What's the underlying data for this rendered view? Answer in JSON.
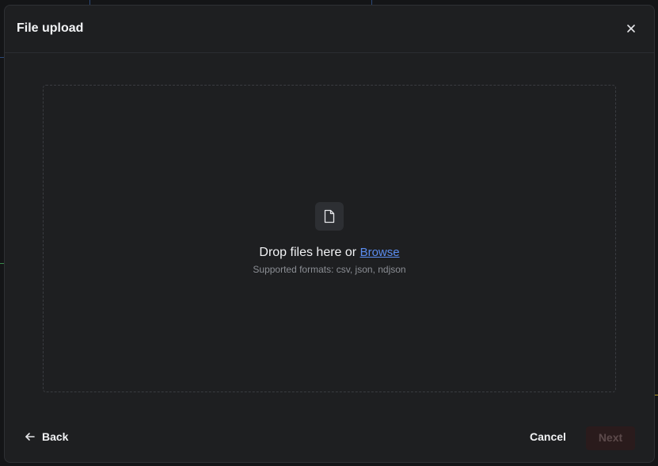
{
  "modal": {
    "title": "File upload",
    "close_icon": "close-icon"
  },
  "dropzone": {
    "icon": "file-icon",
    "prompt": "Drop files here or",
    "browse_label": "Browse",
    "formats_text": "Supported formats: csv, json, ndjson"
  },
  "footer": {
    "back_label": "Back",
    "back_icon": "arrow-left-icon",
    "cancel_label": "Cancel",
    "next_label": "Next"
  },
  "colors": {
    "accent_link": "#5b8def",
    "modal_bg": "#1e1f21",
    "next_disabled_bg": "#2a1b1c"
  }
}
